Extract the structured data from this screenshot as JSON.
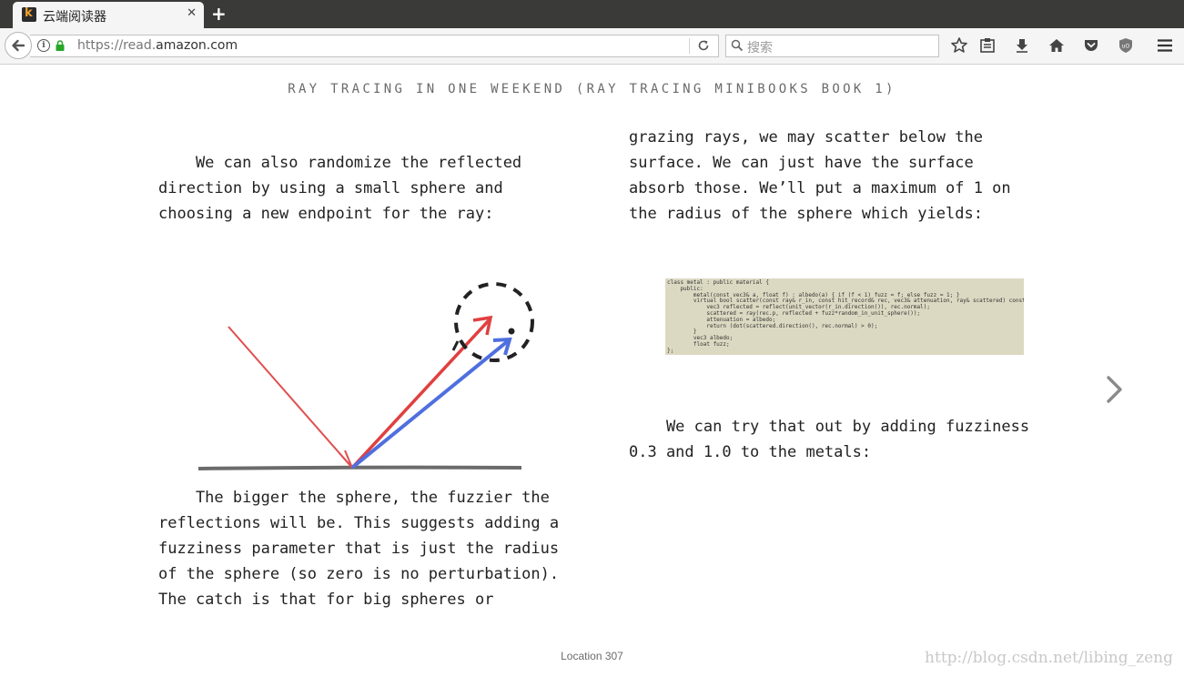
{
  "browser": {
    "tab_title": "云端阅读器",
    "tab_close": "✕",
    "new_tab": "+",
    "url_scheme": "https://read.",
    "url_domain": "amazon.com",
    "search_placeholder": "搜索",
    "icons": [
      "back-arrow-icon",
      "info-icon",
      "lock-icon",
      "reload-icon",
      "search-icon",
      "star-icon",
      "reading-list-icon",
      "download-icon",
      "home-icon",
      "pocket-icon",
      "ublock-icon",
      "menu-icon"
    ]
  },
  "reader": {
    "book_title": "RAY TRACING IN ONE WEEKEND (RAY TRACING MINIBOOKS BOOK 1)",
    "col1_para1": [
      "    We can also randomize the reflected",
      "direction by using a small sphere and",
      "choosing a new endpoint for the ray:"
    ],
    "col1_para2": [
      "    The bigger the sphere, the fuzzier the",
      "reflections will be. This suggests adding a",
      "fuzziness parameter that is just the radius",
      "of the sphere (so zero is no perturbation).",
      "The catch is that for big spheres or"
    ],
    "col2_para1": [
      "grazing rays, we may scatter below the",
      "surface. We can just have the surface",
      "absorb those. We’ll put a maximum of 1 on",
      "the radius of the sphere which yields:"
    ],
    "col2_para2": [
      "    We can try that out by adding fuzziness",
      "0.3 and 1.0 to the metals:"
    ],
    "code_lines": [
      "class metal : public material {",
      "    public:",
      "        metal(const vec3& a, float f) : albedo(a) { if (f < 1) fuzz = f; else fuzz = 1; }",
      "        virtual bool scatter(const ray& r_in, const hit_record& rec, vec3& attenuation, ray& scattered) const  {",
      "            vec3 reflected = reflect(unit_vector(r_in.direction()), rec.normal);",
      "            scattered = ray(rec.p, reflected + fuzz*random_in_unit_sphere());",
      "            attenuation = albedo;",
      "            return (dot(scattered.direction(), rec.normal) > 0);",
      "        }",
      "        vec3 albedo;",
      "        float fuzz;",
      "};"
    ],
    "location": "Location 307",
    "next_icon": "chevron-right-icon"
  },
  "watermark": "http://blog.csdn.net/libing_zeng"
}
